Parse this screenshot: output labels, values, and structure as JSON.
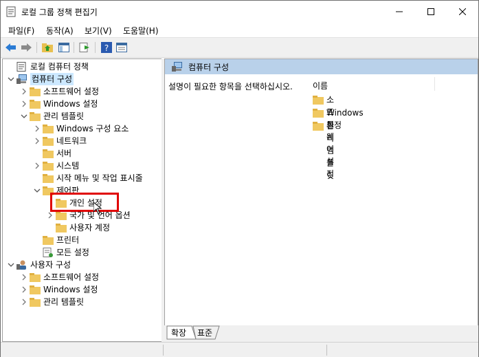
{
  "window": {
    "title": "로컬 그룹 정책 편집기"
  },
  "menu": [
    "파일(F)",
    "동작(A)",
    "보기(V)",
    "도움말(H)"
  ],
  "tree": [
    {
      "label": "로컬 컴퓨터 정책",
      "level": 0,
      "expander": "",
      "icon": "policy-icon"
    },
    {
      "label": "컴퓨터 구성",
      "level": 0,
      "expander": "open",
      "icon": "computer-icon",
      "selected": true
    },
    {
      "label": "소프트웨어 설정",
      "level": 1,
      "expander": "closed",
      "icon": "folder-icon"
    },
    {
      "label": "Windows 설정",
      "level": 1,
      "expander": "closed",
      "icon": "folder-icon"
    },
    {
      "label": "관리 템플릿",
      "level": 1,
      "expander": "open",
      "icon": "folder-icon"
    },
    {
      "label": "Windows 구성 요소",
      "level": 2,
      "expander": "closed",
      "icon": "folder-icon"
    },
    {
      "label": "네트워크",
      "level": 2,
      "expander": "closed",
      "icon": "folder-icon"
    },
    {
      "label": "서버",
      "level": 2,
      "expander": "",
      "icon": "folder-icon"
    },
    {
      "label": "시스템",
      "level": 2,
      "expander": "closed",
      "icon": "folder-icon"
    },
    {
      "label": "시작 메뉴 및 작업 표시줄",
      "level": 2,
      "expander": "",
      "icon": "folder-icon"
    },
    {
      "label": "제어판",
      "level": 2,
      "expander": "open",
      "icon": "folder-icon"
    },
    {
      "label": "개인 설정",
      "level": 3,
      "expander": "",
      "icon": "folder-icon"
    },
    {
      "label": "국가 및 언어 옵션",
      "level": 3,
      "expander": "closed",
      "icon": "folder-icon"
    },
    {
      "label": "사용자 계정",
      "level": 3,
      "expander": "",
      "icon": "folder-icon"
    },
    {
      "label": "프린터",
      "level": 2,
      "expander": "",
      "icon": "folder-icon"
    },
    {
      "label": "모든 설정",
      "level": 2,
      "expander": "",
      "icon": "settings-icon"
    },
    {
      "label": "사용자 구성",
      "level": 0,
      "expander": "open",
      "icon": "user-icon"
    },
    {
      "label": "소프트웨어 설정",
      "level": 1,
      "expander": "closed",
      "icon": "folder-icon"
    },
    {
      "label": "Windows 설정",
      "level": 1,
      "expander": "closed",
      "icon": "folder-icon"
    },
    {
      "label": "관리 템플릿",
      "level": 1,
      "expander": "closed",
      "icon": "folder-icon"
    }
  ],
  "right": {
    "header": "컴퓨터 구성",
    "description": "설명이 필요한 항목을 선택하십시오.",
    "column": "이름",
    "items": [
      "소프트웨어 설정",
      "Windows 설정",
      "관리 템플릿"
    ]
  },
  "tabs": [
    "확장",
    "표준"
  ],
  "colors": {
    "header_bg": "#b9d1ea",
    "selection_bg": "#cce8ff",
    "highlight_border": "#e00000",
    "folder": "#f0c860"
  }
}
